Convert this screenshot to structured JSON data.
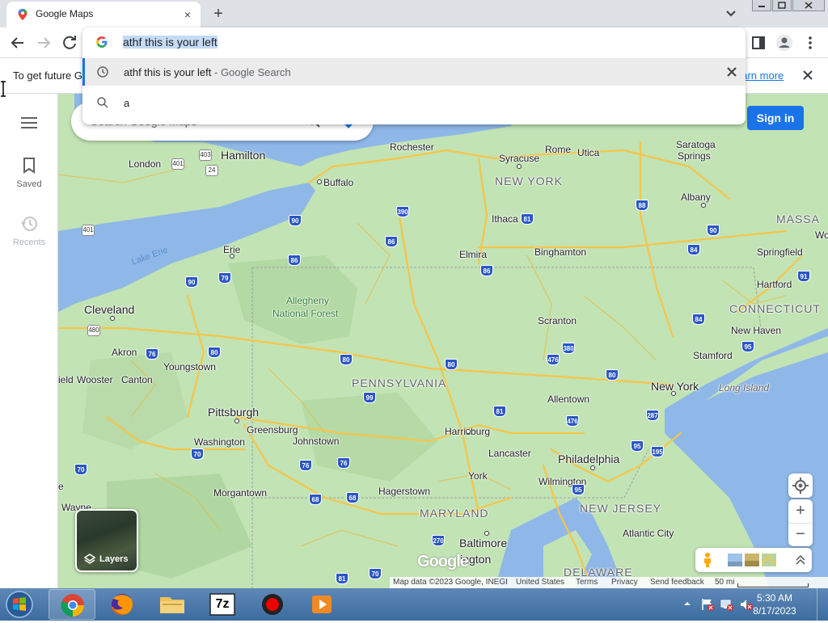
{
  "browser": {
    "tab_title": "Google Maps",
    "close_tab": "×",
    "new_tab": "+"
  },
  "omnibox": {
    "input_value": "athf this is your left",
    "suggestions": [
      {
        "text": "athf this is your left",
        "suffix": " - Google Search",
        "icon": "history-icon"
      },
      {
        "text": "a",
        "icon": "search-icon"
      }
    ]
  },
  "infobar": {
    "text": "To get future G",
    "link": "earn more"
  },
  "rail": {
    "saved": "Saved",
    "recents": "Recents"
  },
  "maps": {
    "search_placeholder": "Search Google Maps",
    "sign_in": "Sign in",
    "layers": "Layers",
    "logo": "Google",
    "zoom_in": "+",
    "zoom_out": "−",
    "footer": {
      "attribution": "Map data ©2023 Google, INEGI",
      "country": "United States",
      "terms": "Terms",
      "privacy": "Privacy",
      "feedback": "Send feedback",
      "scale": "50 mi"
    },
    "colors": {
      "land": "#bfe0b0",
      "water": "#8fb8e8",
      "road": "#f5c54a"
    }
  },
  "map_labels": {
    "rochester": "Rochester",
    "syracuse": "Syracuse",
    "rome": "Rome",
    "utica": "Utica",
    "saratoga": "Saratoga",
    "springs": "Springs",
    "london": "London",
    "hamilton": "Hamilton",
    "buffalo": "Buffalo",
    "new_york_state": "NEW YORK",
    "albany": "Albany",
    "massa": "MASSA",
    "ithaca": "Ithaca",
    "lake_erie": "Lake Erie",
    "erie": "Erie",
    "elmira": "Elmira",
    "binghamton": "Binghamton",
    "springfield": "Springfield",
    "hartford": "Hartford",
    "allegheny": "Allegheny",
    "national_forest": "National Forest",
    "cleveland": "Cleveland",
    "connecticut": "CONNECTICUT",
    "scranton": "Scranton",
    "new_haven": "New Haven",
    "akron": "Akron",
    "stamford": "Stamford",
    "youngstown": "Youngstown",
    "wooster": "Wooster",
    "canton": "Canton",
    "pennsylvania": "PENNSYLVANIA",
    "new_york_city": "New York",
    "long_island": "Long Island",
    "allentown": "Allentown",
    "pittsburgh": "Pittsburgh",
    "greensburg": "Greensburg",
    "harrisburg": "Harrisburg",
    "washington": "Washington",
    "johnstown": "Johnstown",
    "lancaster": "Lancaster",
    "philadelphia": "Philadelphia",
    "york": "York",
    "wilmington": "Wilmington",
    "morgantown": "Morgantown",
    "hagerstown": "Hagerstown",
    "maryland": "MARYLAND",
    "new_jersey": "NEW JERSEY",
    "atlantic_city": "Atlantic City",
    "baltimore": "Baltimore",
    "wayne": "Wayne",
    "arlington": "lington",
    "delaware": "DELAWARE",
    "field": "ield",
    "edge_e": "e",
    "edge_wo": "Wo"
  },
  "taskbar": {
    "apps": [
      "start-orb",
      "chrome-icon",
      "firefox-icon",
      "file-explorer-icon",
      "7zip-icon",
      "record-icon",
      "media-player-icon"
    ],
    "sevenzip_label": "7z",
    "time": "5:30 AM",
    "date": "8/17/2023"
  }
}
